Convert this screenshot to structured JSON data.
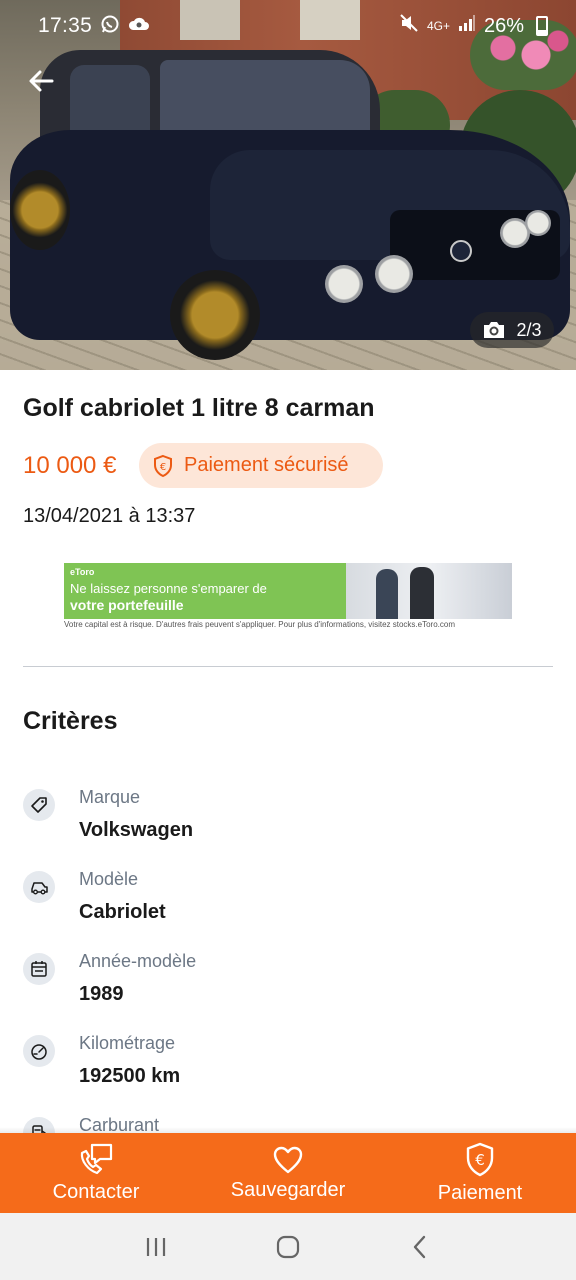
{
  "status_bar": {
    "time": "17:35",
    "network": "4G+",
    "battery": "26%"
  },
  "gallery": {
    "counter": "2/3"
  },
  "listing": {
    "title": "Golf cabriolet 1 litre 8 carman",
    "price": "10 000 €",
    "secure_payment_label": "Paiement sécurisé",
    "date": "13/04/2021 à 13:37"
  },
  "ad": {
    "brand": "eToro",
    "line1": "Ne laissez personne  s'emparer de",
    "line2": "votre portefeuille",
    "footer": "Votre capital est à risque. D'autres frais peuvent s'appliquer. Pour plus d'informations,  visitez stocks.eToro.com"
  },
  "criteria": {
    "title": "Critères",
    "items": [
      {
        "label": "Marque",
        "value": "Volkswagen",
        "icon": "tag-icon"
      },
      {
        "label": "Modèle",
        "value": "Cabriolet",
        "icon": "car-icon"
      },
      {
        "label": "Année-modèle",
        "value": "1989",
        "icon": "calendar-icon"
      },
      {
        "label": "Kilométrage",
        "value": "192500 km",
        "icon": "speedometer-icon"
      },
      {
        "label": "Carburant",
        "value": "",
        "icon": "fuel-pump-icon"
      }
    ]
  },
  "actions": {
    "contact": "Contacter",
    "save": "Sauvegarder",
    "payment": "Paiement"
  },
  "colors": {
    "accent": "#f56b1a",
    "price": "#ec5a13",
    "badge_bg": "#fde6d8",
    "label_grey": "#6c7785"
  }
}
